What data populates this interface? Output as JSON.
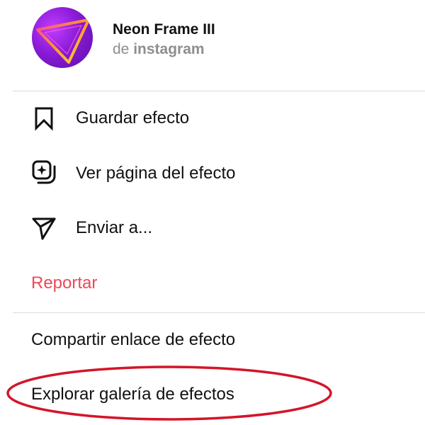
{
  "effect": {
    "title": "Neon Frame III",
    "author_prefix": "de",
    "author_name": "instagram",
    "thumbnail_icon": "neon-triangle-thumbnail"
  },
  "menu": {
    "save": {
      "label": "Guardar efecto",
      "icon": "bookmark-icon"
    },
    "view_page": {
      "label": "Ver página del efecto",
      "icon": "effect-page-icon"
    },
    "send": {
      "label": "Enviar a...",
      "icon": "send-icon"
    },
    "report": {
      "label": "Reportar",
      "color": "#ed4956"
    },
    "share_link": {
      "label": "Compartir enlace de efecto"
    },
    "explore_gallery": {
      "label": "Explorar galería de efectos"
    }
  },
  "colors": {
    "text": "#111111",
    "secondary_text": "#8e8e8e",
    "report": "#ed4956",
    "annotation_circle": "#d3152a",
    "divider": "#dbdbdb"
  }
}
